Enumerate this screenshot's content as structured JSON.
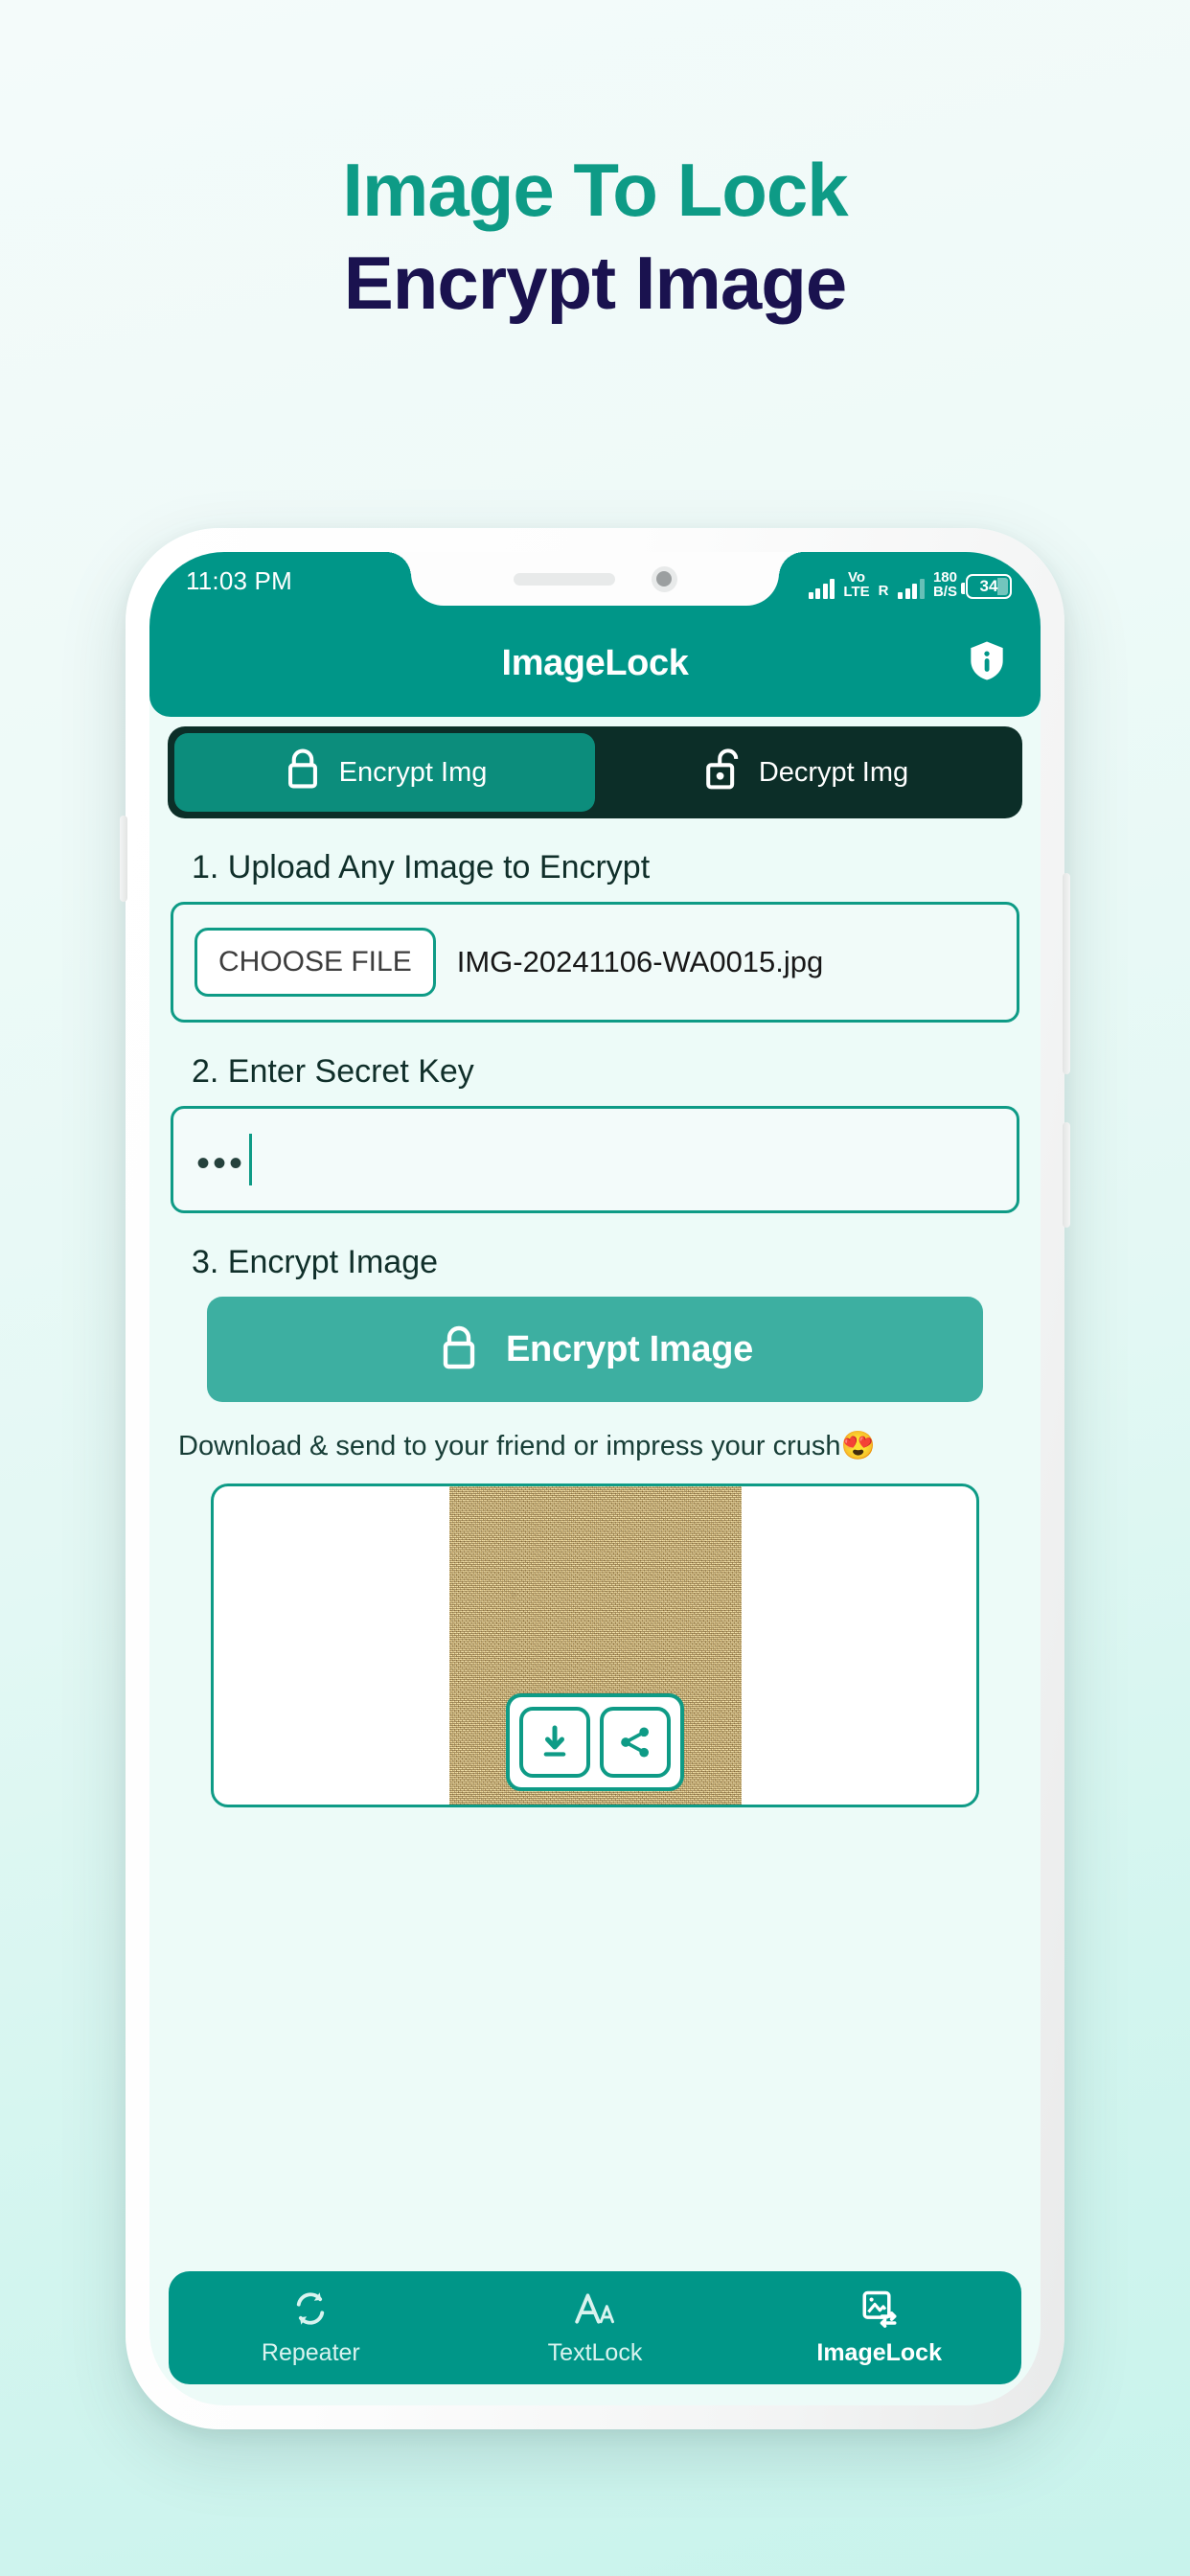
{
  "promo": {
    "line1": "Image To Lock",
    "line2": "Encrypt Image",
    "color_line1": "#0e9b86",
    "color_line2": "#1a124f"
  },
  "phone": {
    "status_bar": {
      "time": "11:03 PM",
      "volte": "Vo",
      "volte2": "LTE",
      "roaming": "R",
      "data_rate_value": "180",
      "data_rate_unit": "B/S",
      "battery_level": "34"
    },
    "app_bar": {
      "title": "ImageLock",
      "info_icon": "shield-info-icon"
    },
    "tabs": [
      {
        "label": "Encrypt Img",
        "icon": "lock-closed-icon",
        "active": true
      },
      {
        "label": "Decrypt Img",
        "icon": "lock-open-icon",
        "active": false
      }
    ],
    "steps": {
      "step1_label": "1. Upload Any Image to Encrypt",
      "choose_file_label": "CHOOSE FILE",
      "file_name": "IMG-20241106-WA0015.jpg",
      "step2_label": "2. Enter Secret Key",
      "secret_key_value": "•••",
      "step3_label": "3. Encrypt Image",
      "encrypt_button_label": "Encrypt Image",
      "encrypt_button_icon": "lock-closed-icon"
    },
    "hint_text": "Download & send to your friend or impress your crush😍",
    "preview": {
      "download_icon": "download-icon",
      "share_icon": "share-icon"
    },
    "bottom_nav": [
      {
        "label": "Repeater",
        "icon": "refresh-icon",
        "active": false
      },
      {
        "label": "TextLock",
        "icon": "text-size-icon",
        "active": false
      },
      {
        "label": "ImageLock",
        "icon": "image-transfer-icon",
        "active": true
      }
    ]
  },
  "colors": {
    "brand_teal": "#009688",
    "accent_teal": "#0e9b86",
    "tab_dark": "#0c2e28",
    "navy": "#1a124f"
  }
}
